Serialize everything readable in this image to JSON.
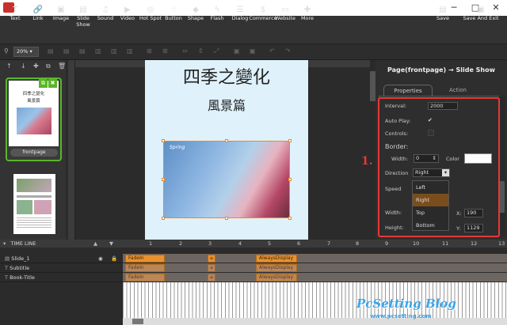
{
  "titlebar": {
    "minimize": "─",
    "maximize": "□",
    "close": "✕"
  },
  "toolbar": {
    "tools": [
      "Text",
      "Link",
      "Image",
      "Slide Show",
      "Sound",
      "Video",
      "Hot Spot",
      "Button",
      "Shape",
      "Flash",
      "Dialog",
      "Commerce",
      "Website",
      "More"
    ],
    "save": "Save",
    "save_exit": "Save And Exit"
  },
  "zoom": {
    "value": "20%"
  },
  "pages": {
    "first_label": "frontpage",
    "thumb_title": "四季之變化",
    "thumb_sub": "風景篇"
  },
  "canvas": {
    "title": "四季之變化",
    "subtitle": "風景篇",
    "slide_caption": "Spring"
  },
  "panel": {
    "header": "Page(frontpage) → Slide Show",
    "tabs": {
      "properties": "Properties",
      "action": "Action"
    },
    "interval_label": "Interval:",
    "interval_value": "2000",
    "autoplay_label": "Auto Play:",
    "autoplay_check": "✔",
    "controls_label": "Controls:",
    "border_label": "Border:",
    "width_label": "Width:",
    "width_value": "0",
    "color_label": "Color",
    "direction_label": "Direction",
    "direction_value": "Right",
    "speed_label": "Speed",
    "w_label": "Width:",
    "h_label": "Height:",
    "x_label": "X:",
    "x_value": "190",
    "y_label": "Y:",
    "y_value": "1129",
    "direction_options": [
      "Left",
      "Right",
      "Top",
      "Bottom"
    ],
    "annotation": "1."
  },
  "timeline": {
    "header": "TIME LINE",
    "ticks": [
      "1",
      "2",
      "3",
      "4",
      "5",
      "6",
      "7",
      "8",
      "9",
      "10",
      "11",
      "12",
      "13"
    ],
    "rows": [
      {
        "name": "Slide_1",
        "clip1": "FadeIn",
        "clip2": "AlwaysDisplay"
      },
      {
        "name": "Subtitle",
        "clip1": "FadeIn",
        "clip2": "AlwaysDisplay"
      },
      {
        "name": "Book-Title",
        "clip1": "FadeIn",
        "clip2": "AlwaysDisplay"
      }
    ]
  },
  "watermark": {
    "title": "PcSetting Blog",
    "url": "www.pcsetting.com"
  }
}
